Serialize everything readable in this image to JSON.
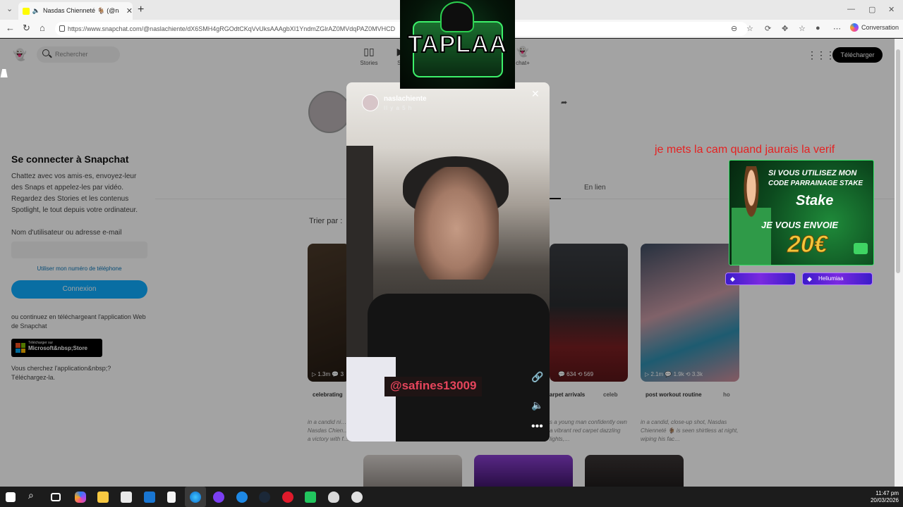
{
  "browser": {
    "tab_title": "Nasdas Chienneté 🐐 (@nasl…",
    "tab_close": "✕",
    "new_tab": "+",
    "url": "https://www.snapchat.com/@naslachiente/dX6SMH4gRGOdtCKqVvUksAAAgbXI1YndmZGlrAZ0MVdqPAZ0MVHCD",
    "conversation_label": "Conversation"
  },
  "snap": {
    "search_placeholder": "Rechercher",
    "nav": [
      {
        "label": "Stories",
        "icon": "stories-icon"
      },
      {
        "label": "Sp",
        "icon": "spotlight-icon"
      },
      {
        "label": "chat+",
        "icon": "snapchat-plus-icon"
      }
    ],
    "download_button": "Télécharger",
    "login": {
      "title": "Se connecter à Snapchat",
      "description": "Chattez avec vos amis·es, envoyez-leur des Snaps et appelez-les par vidéo. Regardez des Stories et les contenus Spotlight, le tout depuis votre ordinateur.",
      "username_label": "Nom d'utilisateur ou adresse e-mail",
      "phone_link": "Utiliser mon numéro de téléphone",
      "connect_button": "Connexion",
      "or_text": "ou continuez en téléchargeant l'application Web de Snapchat",
      "store_small": "Télécharger sur",
      "store_big": "Microsoft&nbsp;Store",
      "looking_for": "Vous cherchez l'application&nbsp;? Téléchargez-la."
    },
    "profile": {
      "tab_linked": "En lien",
      "sort_label": "Trier par :"
    },
    "cards": [
      {
        "stats": "▷ 1.3m  💬 3"
      },
      {
        "stats": "💬 634  ⟲ 569"
      },
      {
        "stats": "▷ 2.1m  💬 1.9k  ⟲ 3.3k"
      }
    ],
    "chips": [
      "celebrating",
      "arpet arrivals",
      "celeb",
      "post workout routine",
      "ho"
    ],
    "captions": [
      "in a candid ni… Nasdas Chien… a victory with f…",
      "s a young man confidently own a vibrant red carpet dazzling lights,…",
      "in a candid, close-up shot, Nasdas Chienneté 🐐 is seen shirtless at night, wiping his fac…"
    ]
  },
  "story": {
    "username": "naslachiente",
    "time": "Il y a 5 h",
    "tag_text": "@safines13009"
  },
  "overlays": {
    "brand": "TAPLAA",
    "stream_message": "je mets la cam quand jaurais la verif",
    "stake": {
      "line1": "SI VOUS UTILISEZ MON",
      "line2": "CODE PARRAINAGE STAKE",
      "brand": "Stake",
      "line3": "JE VOUS ENVOIE",
      "amount": "20€"
    },
    "alerts": [
      "",
      "Heliumiaa"
    ]
  },
  "taskbar": {
    "time": "11:47 pm",
    "date": "20/03/2026"
  }
}
